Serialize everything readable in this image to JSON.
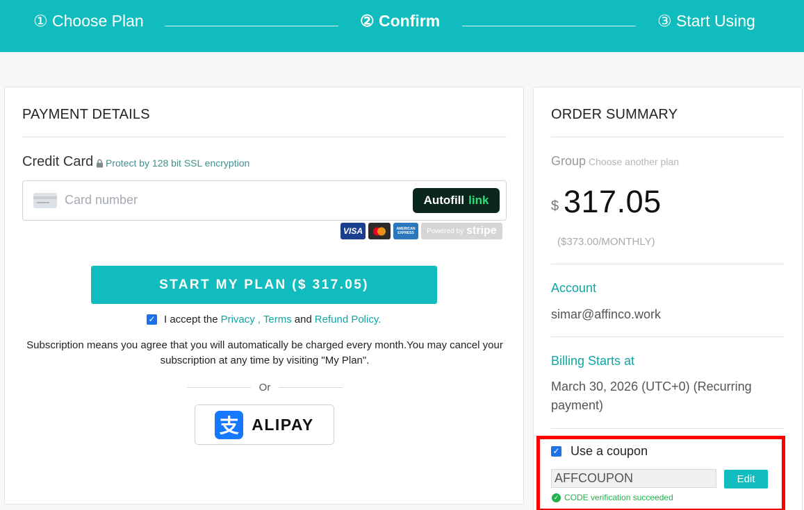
{
  "steps": [
    {
      "label": "① Choose Plan"
    },
    {
      "label": "② Confirm"
    },
    {
      "label": "③ Start Using"
    }
  ],
  "payment": {
    "title": "PAYMENT DETAILS",
    "credit_card_label": "Credit Card",
    "ssl_note": "Protect by 128 bit SSL encryption",
    "card_placeholder": "Card number",
    "autofill_label": "Autofill",
    "autofill_link": "link",
    "badges": [
      "VISA",
      "AMERICAN EXPRESS",
      "Powered by",
      "stripe"
    ],
    "cta_label": "START MY PLAN ($ 317.05)",
    "accept": {
      "prefix": "I accept the",
      "privacy": "Privacy",
      "comma": ",",
      "terms": "Terms",
      "and": "and",
      "refund": "Refund Policy."
    },
    "subscription_note": "Subscription means you agree that you will automatically be charged every month.You may cancel your subscription at any time by visiting \"My Plan\".",
    "or_label": "Or",
    "alipay_glyph": "支",
    "alipay_label": "ALIPAY"
  },
  "order": {
    "title": "ORDER SUMMARY",
    "group_label": "Group",
    "choose_another": "Choose another plan",
    "currency": "$",
    "price": "317.05",
    "monthly": "($373.00/MONTHLY)",
    "account_label": "Account",
    "account_value": "simar@affinco.work",
    "billing_label": "Billing Starts at",
    "billing_value": "March 30, 2026 (UTC+0) (Recurring payment)",
    "coupon_checkbox_label": "Use a coupon",
    "coupon_code": "AFFCOUPON",
    "edit_label": "Edit",
    "verification_msg": "CODE verification succeeded"
  },
  "colors": {
    "teal": "#10bcbd",
    "highlight": "#ff0000",
    "success": "#22b14c",
    "checkbox": "#1a73e8"
  }
}
